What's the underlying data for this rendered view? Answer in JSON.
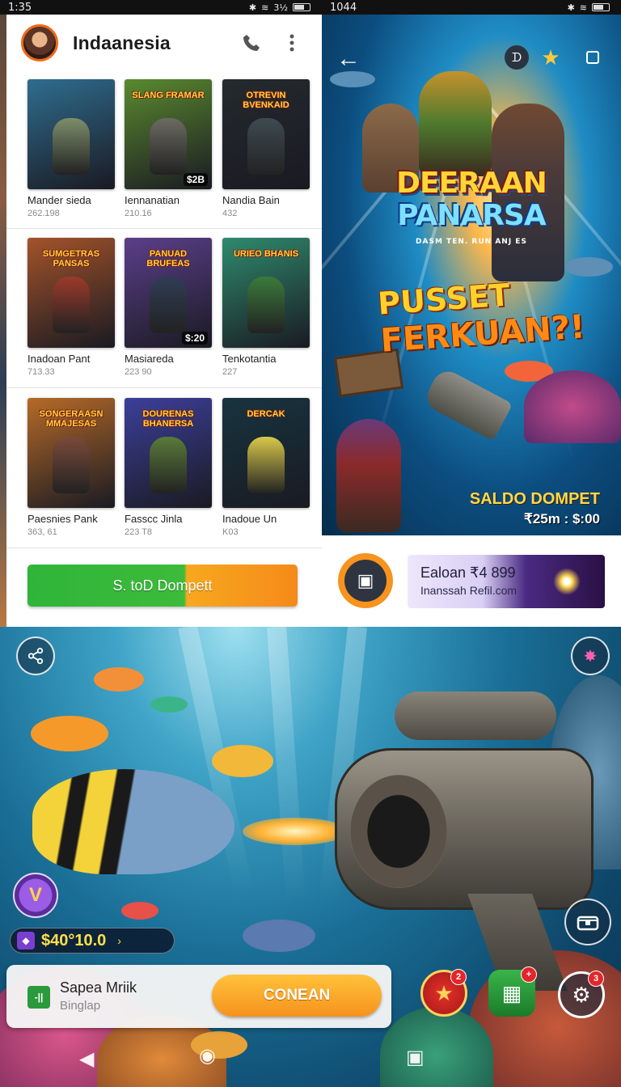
{
  "left_panel": {
    "status": {
      "time": "1:35",
      "battery": "3½"
    },
    "header": {
      "title": "Indaanesia"
    },
    "tiles": [
      {
        "art": "",
        "badge": "",
        "name": "Mander sieda",
        "count": "262.198",
        "bg": "#2f6d8f",
        "fig": "#7d8e6a"
      },
      {
        "art": "SLANG FRAMAR",
        "badge": "$2B",
        "name": "Iennanatian",
        "count": "210.16",
        "bg": "#5a8a2f",
        "fig": "#6b6a62"
      },
      {
        "art": "OTREVIN BVENKAID",
        "badge": "",
        "name": "Nandia Bain",
        "count": "432",
        "bg": "#242a2e",
        "fig": "#3e4a52"
      },
      {
        "art": "SUMGETRAS PANSAS",
        "badge": "",
        "name": "Inadoan Pant",
        "count": "713.33",
        "bg": "#a3532a",
        "fig": "#9c3a2a"
      },
      {
        "art": "PANUAD BRUFEAS",
        "badge": "$:20",
        "name": "Masiareda",
        "count": "223 90",
        "bg": "#5b3f8a",
        "fig": "#2f3d55"
      },
      {
        "art": "URIEO BHANIS",
        "badge": "",
        "name": "Tenkotantia",
        "count": "227",
        "bg": "#2f8a6e",
        "fig": "#3b7a3b"
      },
      {
        "art": "SONGERAASN MMAJESAS",
        "badge": "",
        "name": "Paesnies Pank",
        "count": "363, 61",
        "bg": "#b56a28",
        "fig": "#7a4a3a"
      },
      {
        "art": "DOURENAS BHANERSA",
        "badge": "",
        "name": "Fasscc Jinla",
        "count": "223 T8",
        "bg": "#3c3f9a",
        "fig": "#5a7a3a"
      },
      {
        "art": "DERCAK",
        "badge": "",
        "name": "Inadoue Un",
        "count": "K03",
        "bg": "#17343f",
        "fig": "#d8c84a"
      }
    ],
    "saldo_button": "S. toD Dompett"
  },
  "right_panel": {
    "status": {
      "time": "1044"
    },
    "poster": {
      "title_line1": "DEERAAN",
      "title_line2": "PANARSA",
      "subtitle": "DASM TEN. RUN ANJ ES",
      "headline1": "PUSSET",
      "headline2": "FERKUAN?!",
      "saldo_label": "SALDO DOMPET",
      "saldo_value": "₹25m : $:00"
    },
    "promo": {
      "line1": "Ealoan ₹4 899",
      "line2": "Inanssah Refil.com"
    }
  },
  "game": {
    "wallet": "$40°10.0",
    "badge_glyph": "V",
    "notify": {
      "title": "Sapea Mriik",
      "subtitle": "Binglap",
      "cta": "CONEAN"
    },
    "corner_badges": {
      "star": "2",
      "gift": "+",
      "settings": "3"
    }
  },
  "colors": {
    "accent_orange": "#f7931e",
    "accent_green": "#2fb53a",
    "ocean": "#1a6f97"
  }
}
